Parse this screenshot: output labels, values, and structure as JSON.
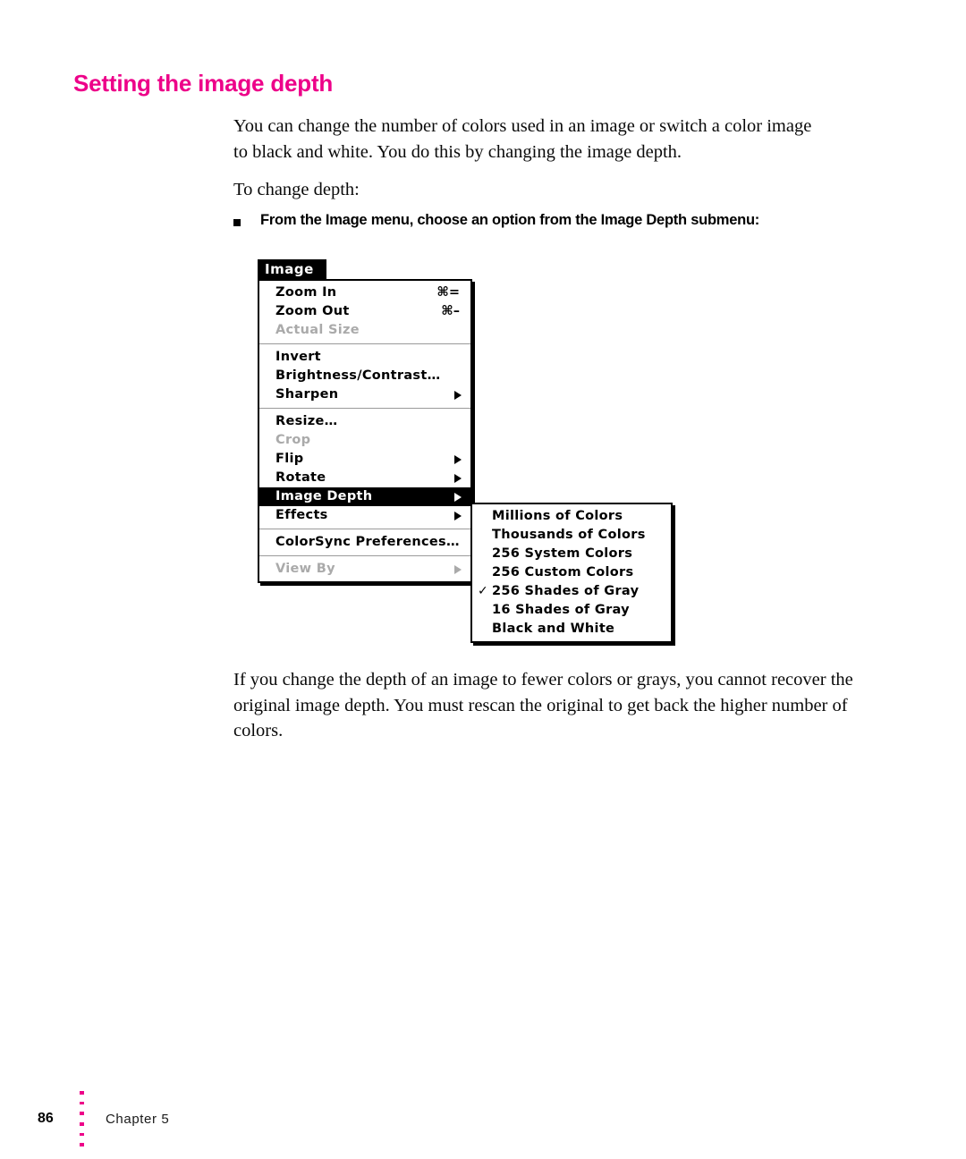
{
  "heading": "Setting the image depth",
  "body": {
    "intro_paragraph": "You can change the number of colors used in an image or switch a color image to black and white. You do this by changing the image depth.",
    "lead_in": "To change depth:",
    "step_bullet_text": "From the Image menu, choose an option from the Image Depth submenu:",
    "closing_paragraph": "If you change the depth of an image to fewer colors or grays, you cannot recover the original image depth. You must rescan the original to get back the higher number of colors."
  },
  "menu_figure": {
    "title": "Image",
    "groups": [
      {
        "items": [
          {
            "label": "Zoom In",
            "shortcut": "⌘=",
            "state": "enabled",
            "submenu": false
          },
          {
            "label": "Zoom Out",
            "shortcut": "⌘–",
            "state": "enabled",
            "submenu": false
          },
          {
            "label": "Actual Size",
            "shortcut": "",
            "state": "disabled",
            "submenu": false
          }
        ]
      },
      {
        "items": [
          {
            "label": "Invert",
            "shortcut": "",
            "state": "enabled",
            "submenu": false
          },
          {
            "label": "Brightness/Contrast…",
            "shortcut": "",
            "state": "enabled",
            "submenu": false
          },
          {
            "label": "Sharpen",
            "shortcut": "",
            "state": "enabled",
            "submenu": true
          }
        ]
      },
      {
        "items": [
          {
            "label": "Resize…",
            "shortcut": "",
            "state": "enabled",
            "submenu": false
          },
          {
            "label": "Crop",
            "shortcut": "",
            "state": "disabled",
            "submenu": false
          },
          {
            "label": "Flip",
            "shortcut": "",
            "state": "enabled",
            "submenu": true
          },
          {
            "label": "Rotate",
            "shortcut": "",
            "state": "enabled",
            "submenu": true
          },
          {
            "label": "Image Depth",
            "shortcut": "",
            "state": "selected",
            "submenu": true
          },
          {
            "label": "Effects",
            "shortcut": "",
            "state": "enabled",
            "submenu": true
          }
        ]
      },
      {
        "items": [
          {
            "label": "ColorSync Preferences…",
            "shortcut": "",
            "state": "enabled",
            "submenu": false
          }
        ]
      },
      {
        "items": [
          {
            "label": "View By",
            "shortcut": "",
            "state": "disabled",
            "submenu": true
          }
        ]
      }
    ],
    "submenu": {
      "parent": "Image Depth",
      "checkmark_glyph": "✓",
      "items": [
        {
          "label": "Millions of Colors",
          "checked": false
        },
        {
          "label": "Thousands of Colors",
          "checked": false
        },
        {
          "label": "256 System Colors",
          "checked": false
        },
        {
          "label": "256 Custom Colors",
          "checked": false
        },
        {
          "label": "256 Shades of Gray",
          "checked": true
        },
        {
          "label": "16 Shades of Gray",
          "checked": false
        },
        {
          "label": "Black and White",
          "checked": false
        }
      ]
    }
  },
  "footer": {
    "page_number": "86",
    "chapter": "Chapter 5",
    "dot_count": 6,
    "dot_color": "#ED0089"
  },
  "colors": {
    "accent": "#ED0089",
    "text": "#000000",
    "disabled_text": "#AAAAAA",
    "menu_background": "#FFFFFF",
    "menu_highlight": "#000000",
    "separator": "#9A9A9A"
  }
}
